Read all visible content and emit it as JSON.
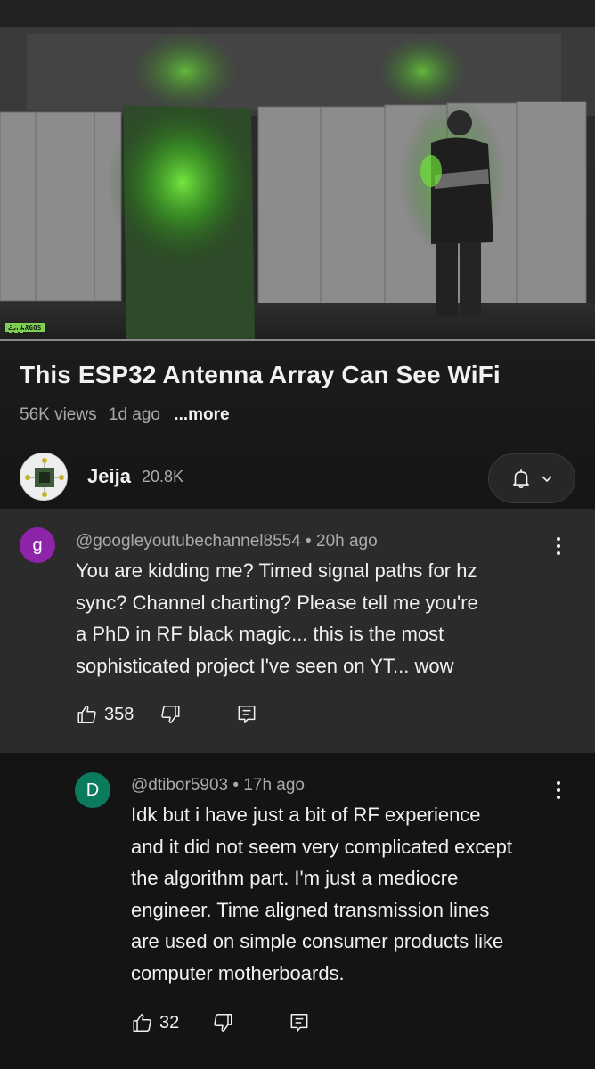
{
  "video": {
    "watermark": "ESPARGOS",
    "progress_fraction": 1.0
  },
  "info": {
    "title": "This ESP32 Antenna Array Can See WiFi",
    "views": "56K views",
    "age": "1d ago",
    "more": "...more"
  },
  "channel": {
    "name": "Jeija",
    "subscribers": "20.8K",
    "bell_icon": "bell-icon",
    "dropdown_icon": "chevron-down-icon"
  },
  "comments": [
    {
      "avatar_letter": "g",
      "avatar_color": "#8e24aa",
      "author": "@googleyoutubechannel8554",
      "time": "20h ago",
      "lines": [
        "You are kidding me? Timed signal paths for hz",
        "sync? Channel charting? Please tell me you're",
        "a PhD in RF black magic... this is the most",
        "sophisticated project I've seen on YT... wow"
      ],
      "likes": "358"
    },
    {
      "avatar_letter": "D",
      "avatar_color": "#0b7b5d",
      "author": "@dtibor5903",
      "time": "17h ago",
      "lines": [
        "Idk but i have just a bit of RF experience",
        "and it did not seem very complicated except",
        "the algorithm part. I'm just a mediocre",
        "engineer. Time aligned transmission lines",
        "are used on simple consumer products like",
        "computer motherboards."
      ],
      "likes": "32"
    }
  ],
  "separator": " • "
}
